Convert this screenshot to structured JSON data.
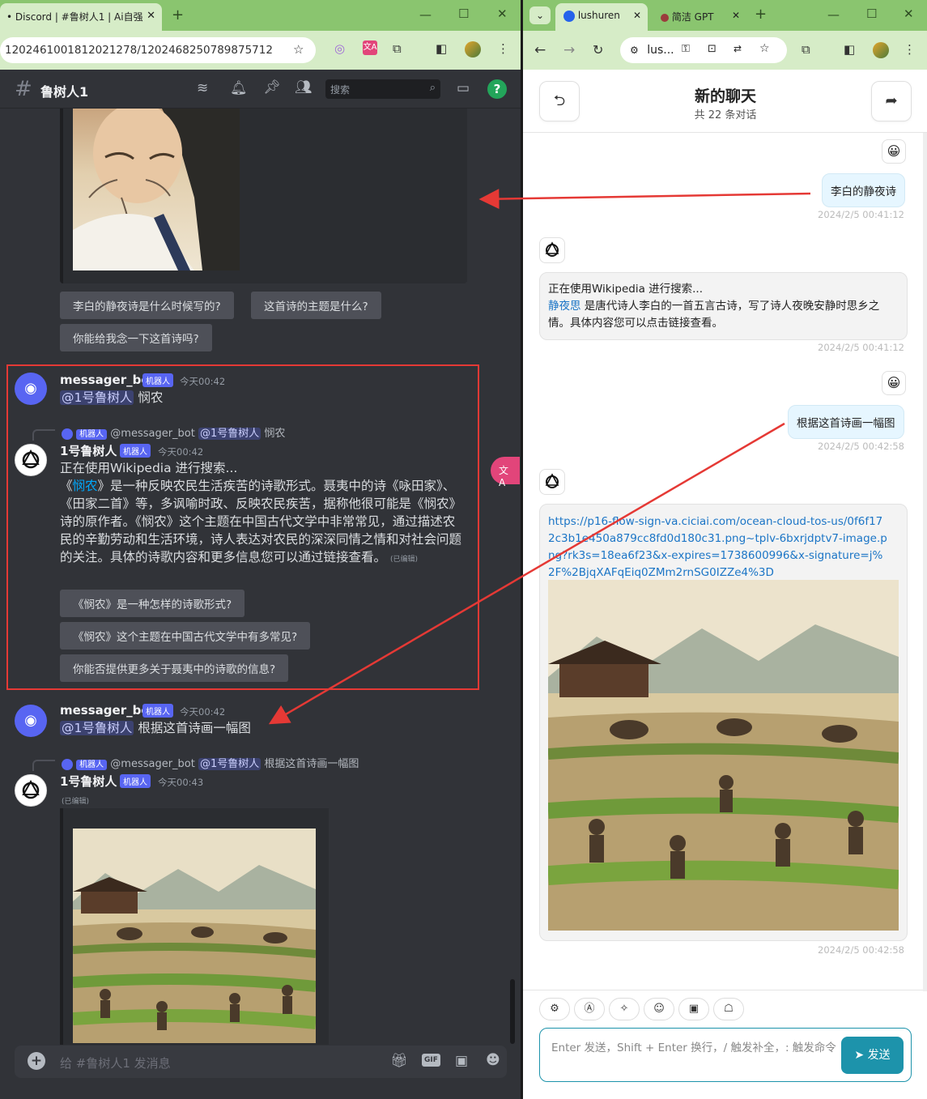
{
  "left_window": {
    "tab_title": "• Discord | #鲁树人1 | Ai自强",
    "url": "1202461001812021278/1202468250789875712",
    "channel": {
      "hash": "#",
      "name": "鲁树人1",
      "search_placeholder": "搜索"
    },
    "suggestions_top": [
      "李白的静夜诗是什么时候写的?",
      "这首诗的主题是什么?",
      "你能给我念一下这首诗吗?"
    ],
    "msg1": {
      "user": "messager_bot",
      "bot_tag": "机器人",
      "time": "今天00:42",
      "mention": "@1号鲁树人",
      "text": "悯农"
    },
    "reply1": {
      "bot_tag": "机器人",
      "author": "@messager_bot",
      "mention": "@1号鲁树人",
      "text": "悯农"
    },
    "msg2": {
      "user": "1号鲁树人",
      "bot_tag": "机器人",
      "time": "今天00:42",
      "line1": "正在使用Wikipedia 进行搜索...",
      "link_open": "《",
      "link": "悯农",
      "link_close": "》",
      "body": "是一种反映农民生活疾苦的诗歌形式。聂夷中的诗《咏田家》、《田家二首》等，多讽喻时政、反映农民疾苦，据称他很可能是《悯农》诗的原作者。《悯农》这个主题在中国古代文学中非常常见，通过描述农民的辛勤劳动和生活环境，诗人表达对农民的深深同情之情和对社会问题的关注。具体的诗歌内容和更多信息您可以通过链接查看。",
      "edited": "(已编辑)",
      "suggestions": [
        "《悯农》是一种怎样的诗歌形式?",
        "《悯农》这个主题在中国古代文学中有多常见?",
        "你能否提供更多关于聂夷中的诗歌的信息?"
      ]
    },
    "msg3": {
      "user": "messager_bot",
      "bot_tag": "机器人",
      "time": "今天00:42",
      "mention": "@1号鲁树人",
      "text": "根据这首诗画一幅图"
    },
    "reply2": {
      "bot_tag": "机器人",
      "author": "@messager_bot",
      "mention": "@1号鲁树人",
      "text": "根据这首诗画一幅图"
    },
    "msg4": {
      "user": "1号鲁树人",
      "bot_tag": "机器人",
      "time": "今天00:43",
      "edited": "(已编辑)"
    },
    "composer_placeholder": "给 #鲁树人1 发消息",
    "gif_label": "GIF"
  },
  "right_window": {
    "tabs": [
      "lushuren",
      "简洁 GPT"
    ],
    "url": "lus...",
    "header": {
      "title": "新的聊天",
      "subtitle": "共 22 条对话"
    },
    "q1": {
      "text": "李白的静夜诗",
      "time": "2024/2/5 00:41:12"
    },
    "a1": {
      "line1": "正在使用Wikipedia 进行搜索...",
      "link": "静夜思",
      "text": "是唐代诗人李白的一首五言古诗，写了诗人夜晚安静时思乡之情。具体内容您可以点击链接查看。",
      "time": "2024/2/5 00:41:12"
    },
    "q2": {
      "text": "根据这首诗画一幅图",
      "time": "2024/2/5 00:42:58"
    },
    "a2": {
      "url": "https://p16-flow-sign-va.ciciai.com/ocean-cloud-tos-us/0f6f172c3b1e450a879cc8fd0d180c31.png~tplv-6bxrjdptv7-image.png?rk3s=18ea6f23&x-expires=1738600996&x-signature=j%2F%2BjqXAFqEiq0ZMm2rnSG0IZZe4%3D",
      "time": "2024/2/5 00:42:58"
    },
    "input_placeholder": "Enter 发送，Shift + Enter 换行，/ 触发补全，: 触发命令",
    "send_label": "发送"
  },
  "accent": {
    "discord_blurple": "#5865f2",
    "send_teal": "#1d93ab",
    "annotation_red": "#e53935",
    "chrome_green": "#8ac56f"
  }
}
